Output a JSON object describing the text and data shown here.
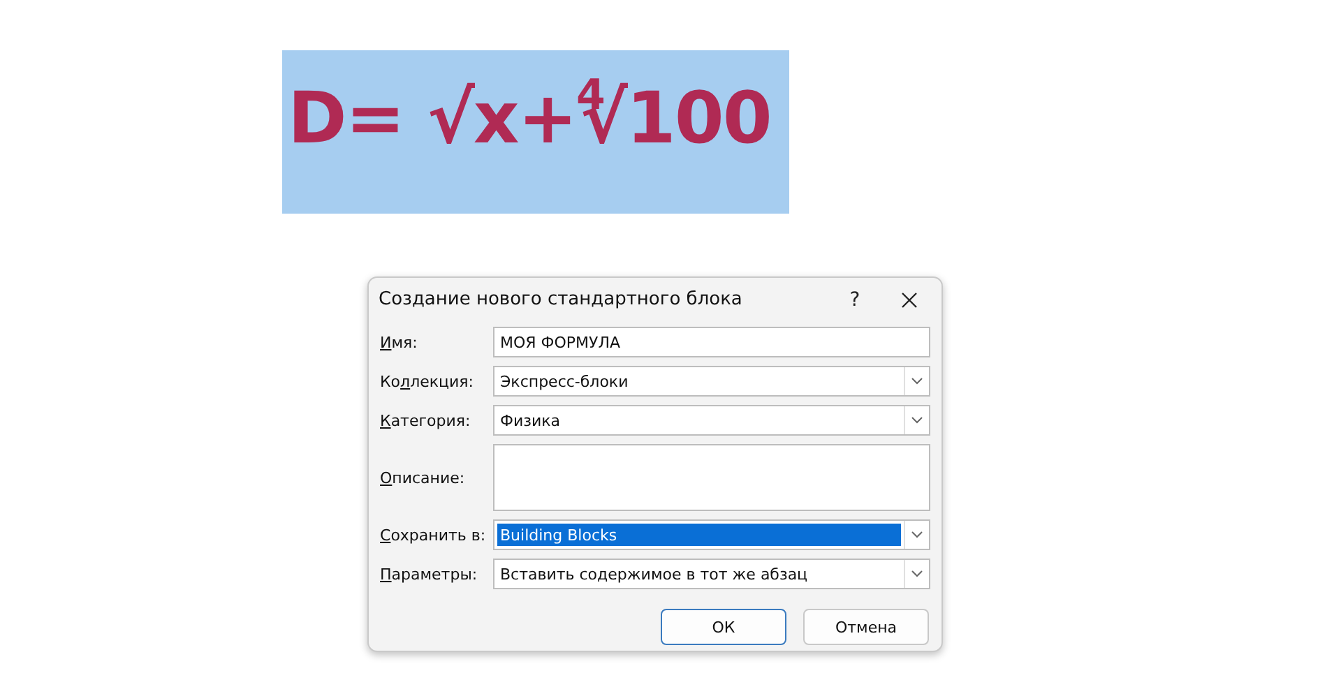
{
  "formula": {
    "text": "D= √x+$^{4}$√100"
  },
  "dialog": {
    "title": "Создание нового стандартного блока",
    "help": "?",
    "fields": [
      {
        "kind": "text",
        "label_parts": [
          {
            "text": "И",
            "underlined": true
          },
          {
            "text": "мя:",
            "underlined": false
          }
        ],
        "value": "МОЯ ФОРМУЛА"
      },
      {
        "kind": "combo",
        "label_parts": [
          {
            "text": "Ко",
            "underlined": false
          },
          {
            "text": "л",
            "underlined": true
          },
          {
            "text": "лекция:",
            "underlined": false
          }
        ],
        "value": "Экспресс-блоки",
        "highlighted": false
      },
      {
        "kind": "combo",
        "label_parts": [
          {
            "text": "К",
            "underlined": true
          },
          {
            "text": "атегория:",
            "underlined": false
          }
        ],
        "value": "Физика",
        "highlighted": false
      },
      {
        "kind": "textarea",
        "label_parts": [
          {
            "text": "О",
            "underlined": true
          },
          {
            "text": "писание:",
            "underlined": false
          }
        ]
      },
      {
        "kind": "combo",
        "label_parts": [
          {
            "text": "С",
            "underlined": true
          },
          {
            "text": "охранить в:",
            "underlined": false
          }
        ],
        "value": "Building Blocks",
        "highlighted": true
      },
      {
        "kind": "combo",
        "label_parts": [
          {
            "text": "П",
            "underlined": true
          },
          {
            "text": "араметры:",
            "underlined": false
          }
        ],
        "value": "Вставить содержимое в тот же абзац",
        "highlighted": false
      }
    ],
    "buttons": [
      {
        "label": "ОК",
        "default": true
      },
      {
        "label": "Отмена",
        "default": false
      }
    ]
  }
}
